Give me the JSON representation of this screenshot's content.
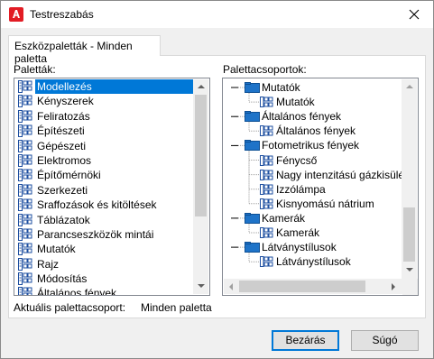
{
  "window": {
    "title": "Testreszabás"
  },
  "tab": {
    "label": "Eszközpaletták - Minden paletta"
  },
  "palettes": {
    "label": "Paletták:",
    "items": [
      "Modellezés",
      "Kényszerek",
      "Feliratozás",
      "Építészeti",
      "Gépészeti",
      "Elektromos",
      "Építőmérnöki",
      "Szerkezeti",
      "Sraffozások és kitöltések",
      "Táblázatok",
      "Parancseszközök mintái",
      "Mutatók",
      "Rajz",
      "Módosítás",
      "Általános fények"
    ],
    "selected_index": 0
  },
  "groups": {
    "label": "Palettacsoportok:",
    "tree": [
      {
        "label": "Mutatók",
        "level": 0
      },
      {
        "label": "Mutatók",
        "level": 1
      },
      {
        "label": "Általános fények",
        "level": 0
      },
      {
        "label": "Általános fények",
        "level": 1
      },
      {
        "label": "Fotometrikus fények",
        "level": 0
      },
      {
        "label": "Fénycső",
        "level": 1
      },
      {
        "label": "Nagy intenzitású gázkisülésű",
        "level": 1
      },
      {
        "label": "Izzólámpa",
        "level": 1
      },
      {
        "label": "Kisnyomású nátrium",
        "level": 1
      },
      {
        "label": "Kamerák",
        "level": 0
      },
      {
        "label": "Kamerák",
        "level": 1
      },
      {
        "label": "Látványstílusok",
        "level": 0
      },
      {
        "label": "Látványstílusok",
        "level": 1
      }
    ]
  },
  "current": {
    "label": "Aktuális palettacsoport:",
    "value": "Minden paletta"
  },
  "buttons": {
    "close": "Bezárás",
    "help": "Súgó"
  },
  "colors": {
    "accent": "#0078d7",
    "folder": "#1e73c8",
    "app_icon": "#e21c24"
  },
  "icons": {
    "close": "close-icon",
    "app": "autocad-icon",
    "palette": "palette-icon",
    "folder": "folder-icon"
  }
}
